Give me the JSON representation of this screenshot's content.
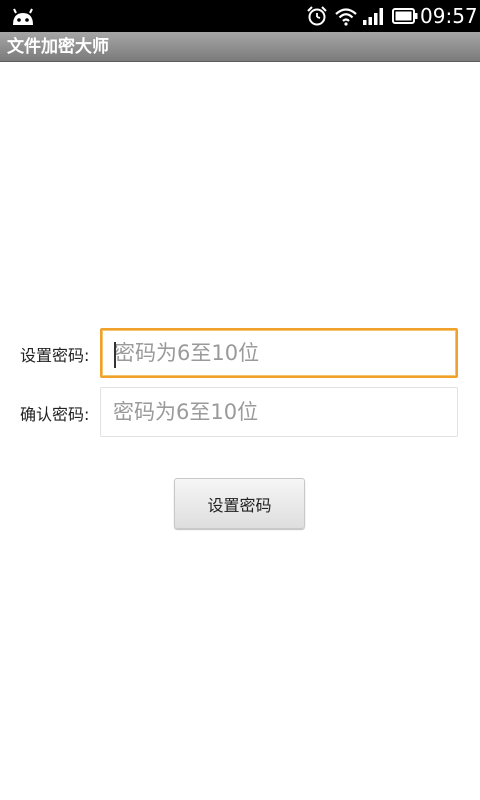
{
  "status_bar": {
    "time": "09:57",
    "icons": [
      "android-icon",
      "alarm-icon",
      "wifi-icon",
      "signal-icon",
      "battery-icon"
    ]
  },
  "app": {
    "title": "文件加密大师"
  },
  "form": {
    "password_label": "设置密码:",
    "password_placeholder": "密码为6至10位",
    "password_value": "",
    "confirm_label": "确认密码:",
    "confirm_placeholder": "密码为6至10位",
    "confirm_value": "",
    "submit_label": "设置密码"
  },
  "colors": {
    "focus_border": "#f0a12c",
    "titlebar": "#8f8f8f",
    "statusbar": "#000000"
  }
}
